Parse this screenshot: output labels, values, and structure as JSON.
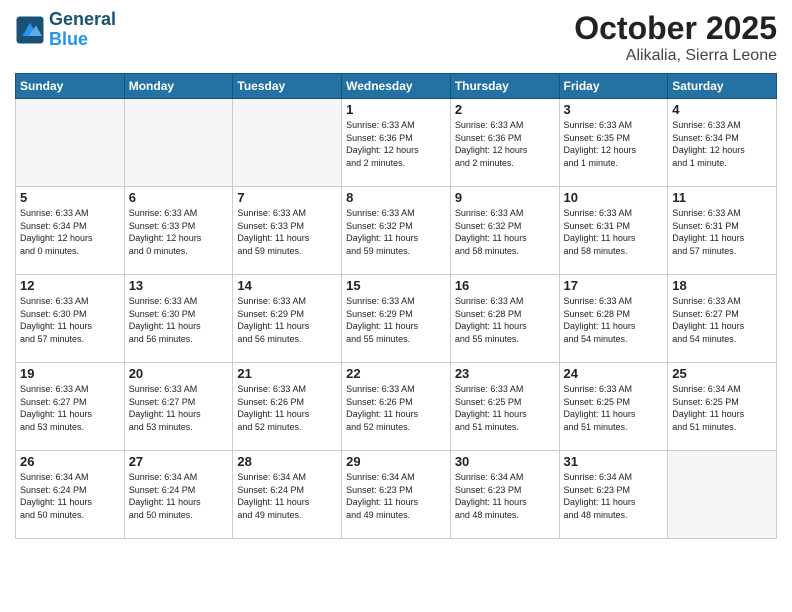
{
  "header": {
    "logo_line1": "General",
    "logo_line2": "Blue",
    "month": "October 2025",
    "location": "Alikalia, Sierra Leone"
  },
  "weekdays": [
    "Sunday",
    "Monday",
    "Tuesday",
    "Wednesday",
    "Thursday",
    "Friday",
    "Saturday"
  ],
  "weeks": [
    [
      {
        "num": "",
        "info": ""
      },
      {
        "num": "",
        "info": ""
      },
      {
        "num": "",
        "info": ""
      },
      {
        "num": "1",
        "info": "Sunrise: 6:33 AM\nSunset: 6:36 PM\nDaylight: 12 hours\nand 2 minutes."
      },
      {
        "num": "2",
        "info": "Sunrise: 6:33 AM\nSunset: 6:36 PM\nDaylight: 12 hours\nand 2 minutes."
      },
      {
        "num": "3",
        "info": "Sunrise: 6:33 AM\nSunset: 6:35 PM\nDaylight: 12 hours\nand 1 minute."
      },
      {
        "num": "4",
        "info": "Sunrise: 6:33 AM\nSunset: 6:34 PM\nDaylight: 12 hours\nand 1 minute."
      }
    ],
    [
      {
        "num": "5",
        "info": "Sunrise: 6:33 AM\nSunset: 6:34 PM\nDaylight: 12 hours\nand 0 minutes."
      },
      {
        "num": "6",
        "info": "Sunrise: 6:33 AM\nSunset: 6:33 PM\nDaylight: 12 hours\nand 0 minutes."
      },
      {
        "num": "7",
        "info": "Sunrise: 6:33 AM\nSunset: 6:33 PM\nDaylight: 11 hours\nand 59 minutes."
      },
      {
        "num": "8",
        "info": "Sunrise: 6:33 AM\nSunset: 6:32 PM\nDaylight: 11 hours\nand 59 minutes."
      },
      {
        "num": "9",
        "info": "Sunrise: 6:33 AM\nSunset: 6:32 PM\nDaylight: 11 hours\nand 58 minutes."
      },
      {
        "num": "10",
        "info": "Sunrise: 6:33 AM\nSunset: 6:31 PM\nDaylight: 11 hours\nand 58 minutes."
      },
      {
        "num": "11",
        "info": "Sunrise: 6:33 AM\nSunset: 6:31 PM\nDaylight: 11 hours\nand 57 minutes."
      }
    ],
    [
      {
        "num": "12",
        "info": "Sunrise: 6:33 AM\nSunset: 6:30 PM\nDaylight: 11 hours\nand 57 minutes."
      },
      {
        "num": "13",
        "info": "Sunrise: 6:33 AM\nSunset: 6:30 PM\nDaylight: 11 hours\nand 56 minutes."
      },
      {
        "num": "14",
        "info": "Sunrise: 6:33 AM\nSunset: 6:29 PM\nDaylight: 11 hours\nand 56 minutes."
      },
      {
        "num": "15",
        "info": "Sunrise: 6:33 AM\nSunset: 6:29 PM\nDaylight: 11 hours\nand 55 minutes."
      },
      {
        "num": "16",
        "info": "Sunrise: 6:33 AM\nSunset: 6:28 PM\nDaylight: 11 hours\nand 55 minutes."
      },
      {
        "num": "17",
        "info": "Sunrise: 6:33 AM\nSunset: 6:28 PM\nDaylight: 11 hours\nand 54 minutes."
      },
      {
        "num": "18",
        "info": "Sunrise: 6:33 AM\nSunset: 6:27 PM\nDaylight: 11 hours\nand 54 minutes."
      }
    ],
    [
      {
        "num": "19",
        "info": "Sunrise: 6:33 AM\nSunset: 6:27 PM\nDaylight: 11 hours\nand 53 minutes."
      },
      {
        "num": "20",
        "info": "Sunrise: 6:33 AM\nSunset: 6:27 PM\nDaylight: 11 hours\nand 53 minutes."
      },
      {
        "num": "21",
        "info": "Sunrise: 6:33 AM\nSunset: 6:26 PM\nDaylight: 11 hours\nand 52 minutes."
      },
      {
        "num": "22",
        "info": "Sunrise: 6:33 AM\nSunset: 6:26 PM\nDaylight: 11 hours\nand 52 minutes."
      },
      {
        "num": "23",
        "info": "Sunrise: 6:33 AM\nSunset: 6:25 PM\nDaylight: 11 hours\nand 51 minutes."
      },
      {
        "num": "24",
        "info": "Sunrise: 6:33 AM\nSunset: 6:25 PM\nDaylight: 11 hours\nand 51 minutes."
      },
      {
        "num": "25",
        "info": "Sunrise: 6:34 AM\nSunset: 6:25 PM\nDaylight: 11 hours\nand 51 minutes."
      }
    ],
    [
      {
        "num": "26",
        "info": "Sunrise: 6:34 AM\nSunset: 6:24 PM\nDaylight: 11 hours\nand 50 minutes."
      },
      {
        "num": "27",
        "info": "Sunrise: 6:34 AM\nSunset: 6:24 PM\nDaylight: 11 hours\nand 50 minutes."
      },
      {
        "num": "28",
        "info": "Sunrise: 6:34 AM\nSunset: 6:24 PM\nDaylight: 11 hours\nand 49 minutes."
      },
      {
        "num": "29",
        "info": "Sunrise: 6:34 AM\nSunset: 6:23 PM\nDaylight: 11 hours\nand 49 minutes."
      },
      {
        "num": "30",
        "info": "Sunrise: 6:34 AM\nSunset: 6:23 PM\nDaylight: 11 hours\nand 48 minutes."
      },
      {
        "num": "31",
        "info": "Sunrise: 6:34 AM\nSunset: 6:23 PM\nDaylight: 11 hours\nand 48 minutes."
      },
      {
        "num": "",
        "info": ""
      }
    ]
  ]
}
